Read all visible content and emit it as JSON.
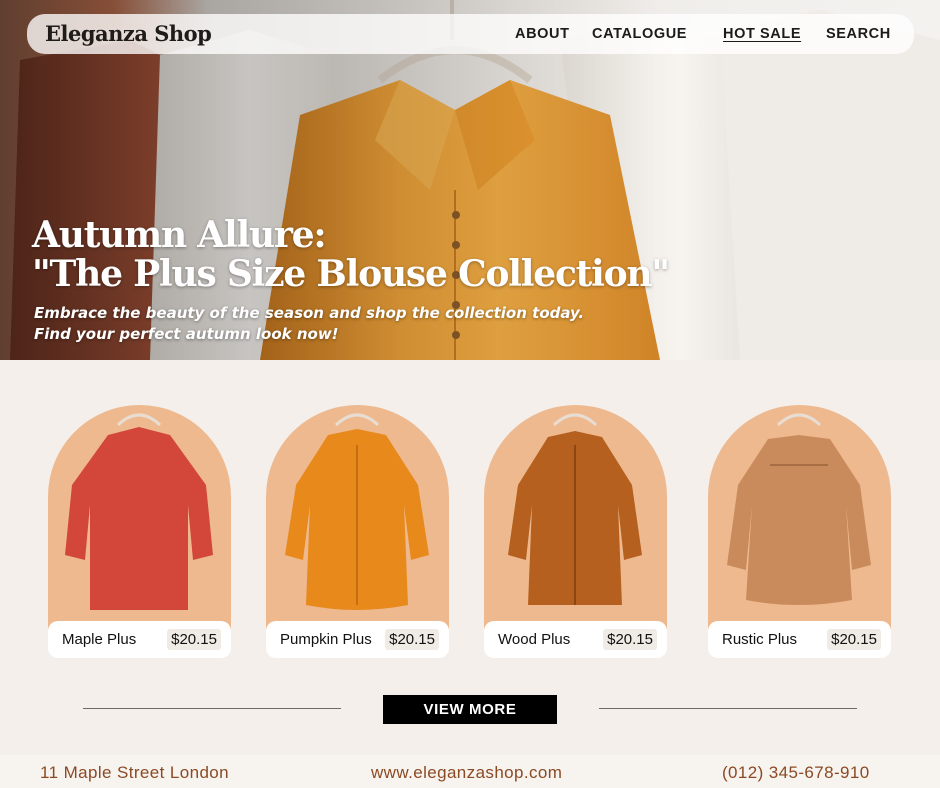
{
  "brand": "Eleganza Shop",
  "nav": {
    "about": "ABOUT",
    "catalogue": "CATALOGUE",
    "hot_sale": "HOT SALE",
    "search": "SEARCH"
  },
  "hero": {
    "headline_1": "Autumn Allure:",
    "headline_2": "\"The Plus Size Blouse Collection\"",
    "tagline_1": "Embrace the beauty of the season and shop the collection today.",
    "tagline_2": "Find your perfect autumn look now!"
  },
  "products": [
    {
      "name": "Maple Plus",
      "price": "$20.15",
      "color": "#d2473a"
    },
    {
      "name": "Pumpkin Plus",
      "price": "$20.15",
      "color": "#e8891c"
    },
    {
      "name": "Wood Plus",
      "price": "$20.15",
      "color": "#b5601f"
    },
    {
      "name": "Rustic Plus",
      "price": "$20.15",
      "color": "#c98b5c"
    }
  ],
  "view_more": "VIEW MORE",
  "footer": {
    "address": "11 Maple Street London",
    "website": "www.eleganzashop.com",
    "phone": "(012) 345-678-910"
  },
  "colors": {
    "accent_footer": "#8a4a24",
    "arch_bg": "#eeb98e",
    "page_bg": "#f4efeb"
  }
}
